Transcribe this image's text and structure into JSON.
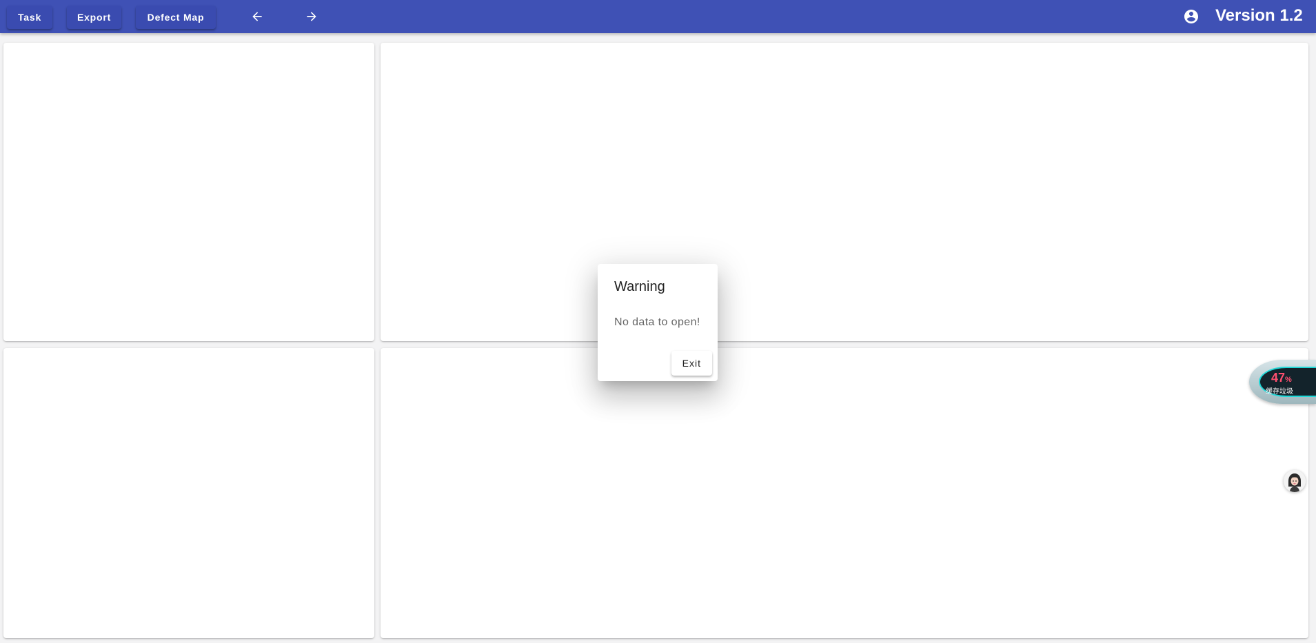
{
  "toolbar": {
    "task_label": "Task",
    "export_label": "Export",
    "defect_map_label": "Defect Map",
    "back_icon": "arrow-left-icon",
    "forward_icon": "arrow-right-icon",
    "account_icon": "account-circle-icon",
    "version_label": "Version 1.2"
  },
  "dialog": {
    "title": "Warning",
    "message": "No data to open!",
    "exit_label": "Exit"
  },
  "widget": {
    "percent_value": "47",
    "percent_sign": "%",
    "label": "缓存垃圾"
  },
  "colors": {
    "primary": "#3f51b5",
    "background": "#f3f3f4",
    "panel": "#ffffff"
  }
}
